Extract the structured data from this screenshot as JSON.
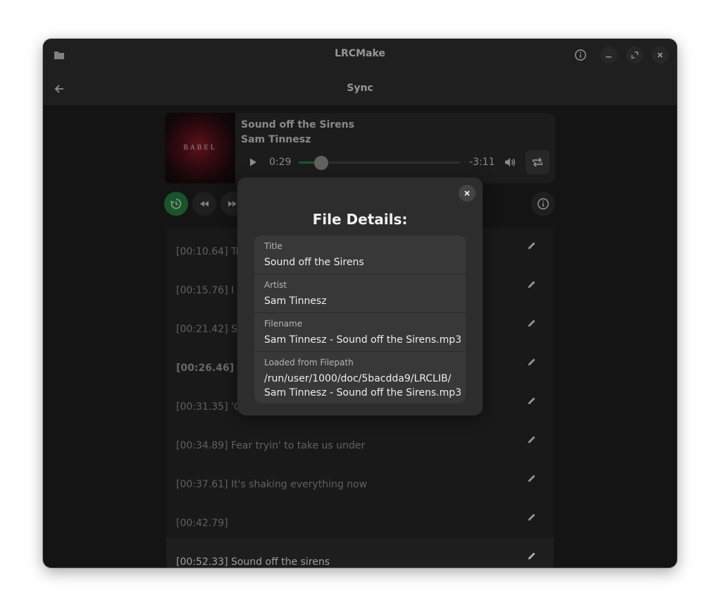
{
  "window": {
    "title": "LRCMake"
  },
  "header": {
    "title": "Sync"
  },
  "player": {
    "album_art_text": "BABEL",
    "song_title": "Sound off the Sirens",
    "song_artist": "Sam Tinnesz",
    "time_elapsed": "0:29",
    "time_remaining": "-3:11",
    "progress_fraction": 0.14
  },
  "lyrics": [
    {
      "text": "[00:10.64] Tr"
    },
    {
      "text": "[00:15.76] I ca"
    },
    {
      "text": "[00:21.42] Sh"
    },
    {
      "text": "[00:26.46] If",
      "current": true
    },
    {
      "text": "[00:31.35] 'Ca"
    },
    {
      "text": "[00:34.89] Fear tryin' to take us under"
    },
    {
      "text": "[00:37.61] It's shaking everything now"
    },
    {
      "text": "[00:42.79]"
    },
    {
      "text": "[00:52.33] Sound off the sirens",
      "active": true
    }
  ],
  "dialog": {
    "title": "File Details:",
    "fields": [
      {
        "label": "Title",
        "value": "Sound off the Sirens"
      },
      {
        "label": "Artist",
        "value": "Sam Tinnesz"
      },
      {
        "label": "Filename",
        "value": "Sam Tinnesz - Sound off the Sirens.mp3"
      },
      {
        "label": "Loaded from Filepath",
        "value": "/run/user/1000/doc/5bacdda9/LRCLIB/\nSam Tinnesz - Sound off the Sirens.mp3"
      }
    ]
  },
  "colors": {
    "accent_green": "#2a7a42",
    "window_bg": "#222222"
  }
}
